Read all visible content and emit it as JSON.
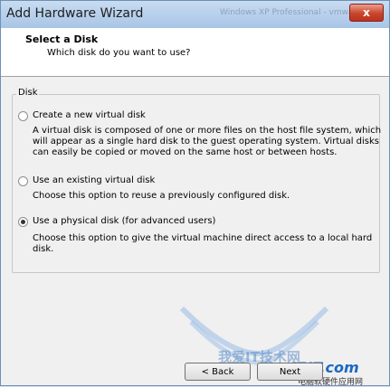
{
  "window": {
    "title": "Add Hardware Wizard",
    "watermark": "Windows XP Professional - vmware",
    "close_glyph": "x"
  },
  "header": {
    "title": "Select a Disk",
    "subtitle": "Which disk do you want to use?"
  },
  "group": {
    "label": "Disk"
  },
  "options": [
    {
      "label": "Create a new virtual disk",
      "selected": false,
      "desc": [
        "A virtual disk is composed of one or more files on the host file system, which",
        "will appear as a single hard disk to the guest operating system. Virtual disks",
        "can easily be copied or moved on the same host or between hosts."
      ]
    },
    {
      "label": "Use an existing virtual disk",
      "selected": false,
      "desc": [
        "Choose this option to reuse a previously configured disk."
      ]
    },
    {
      "label": "Use a physical disk (for advanced users)",
      "selected": true,
      "desc": [
        "Choose this option to give the virtual machine direct access to a local hard",
        "disk."
      ]
    }
  ],
  "buttons": {
    "back": "< Back",
    "next": "Next"
  },
  "watermark": {
    "brand": "45IT.com",
    "tagline": "电脑软硬件应用网",
    "chinese": "我爱IT技术网"
  }
}
